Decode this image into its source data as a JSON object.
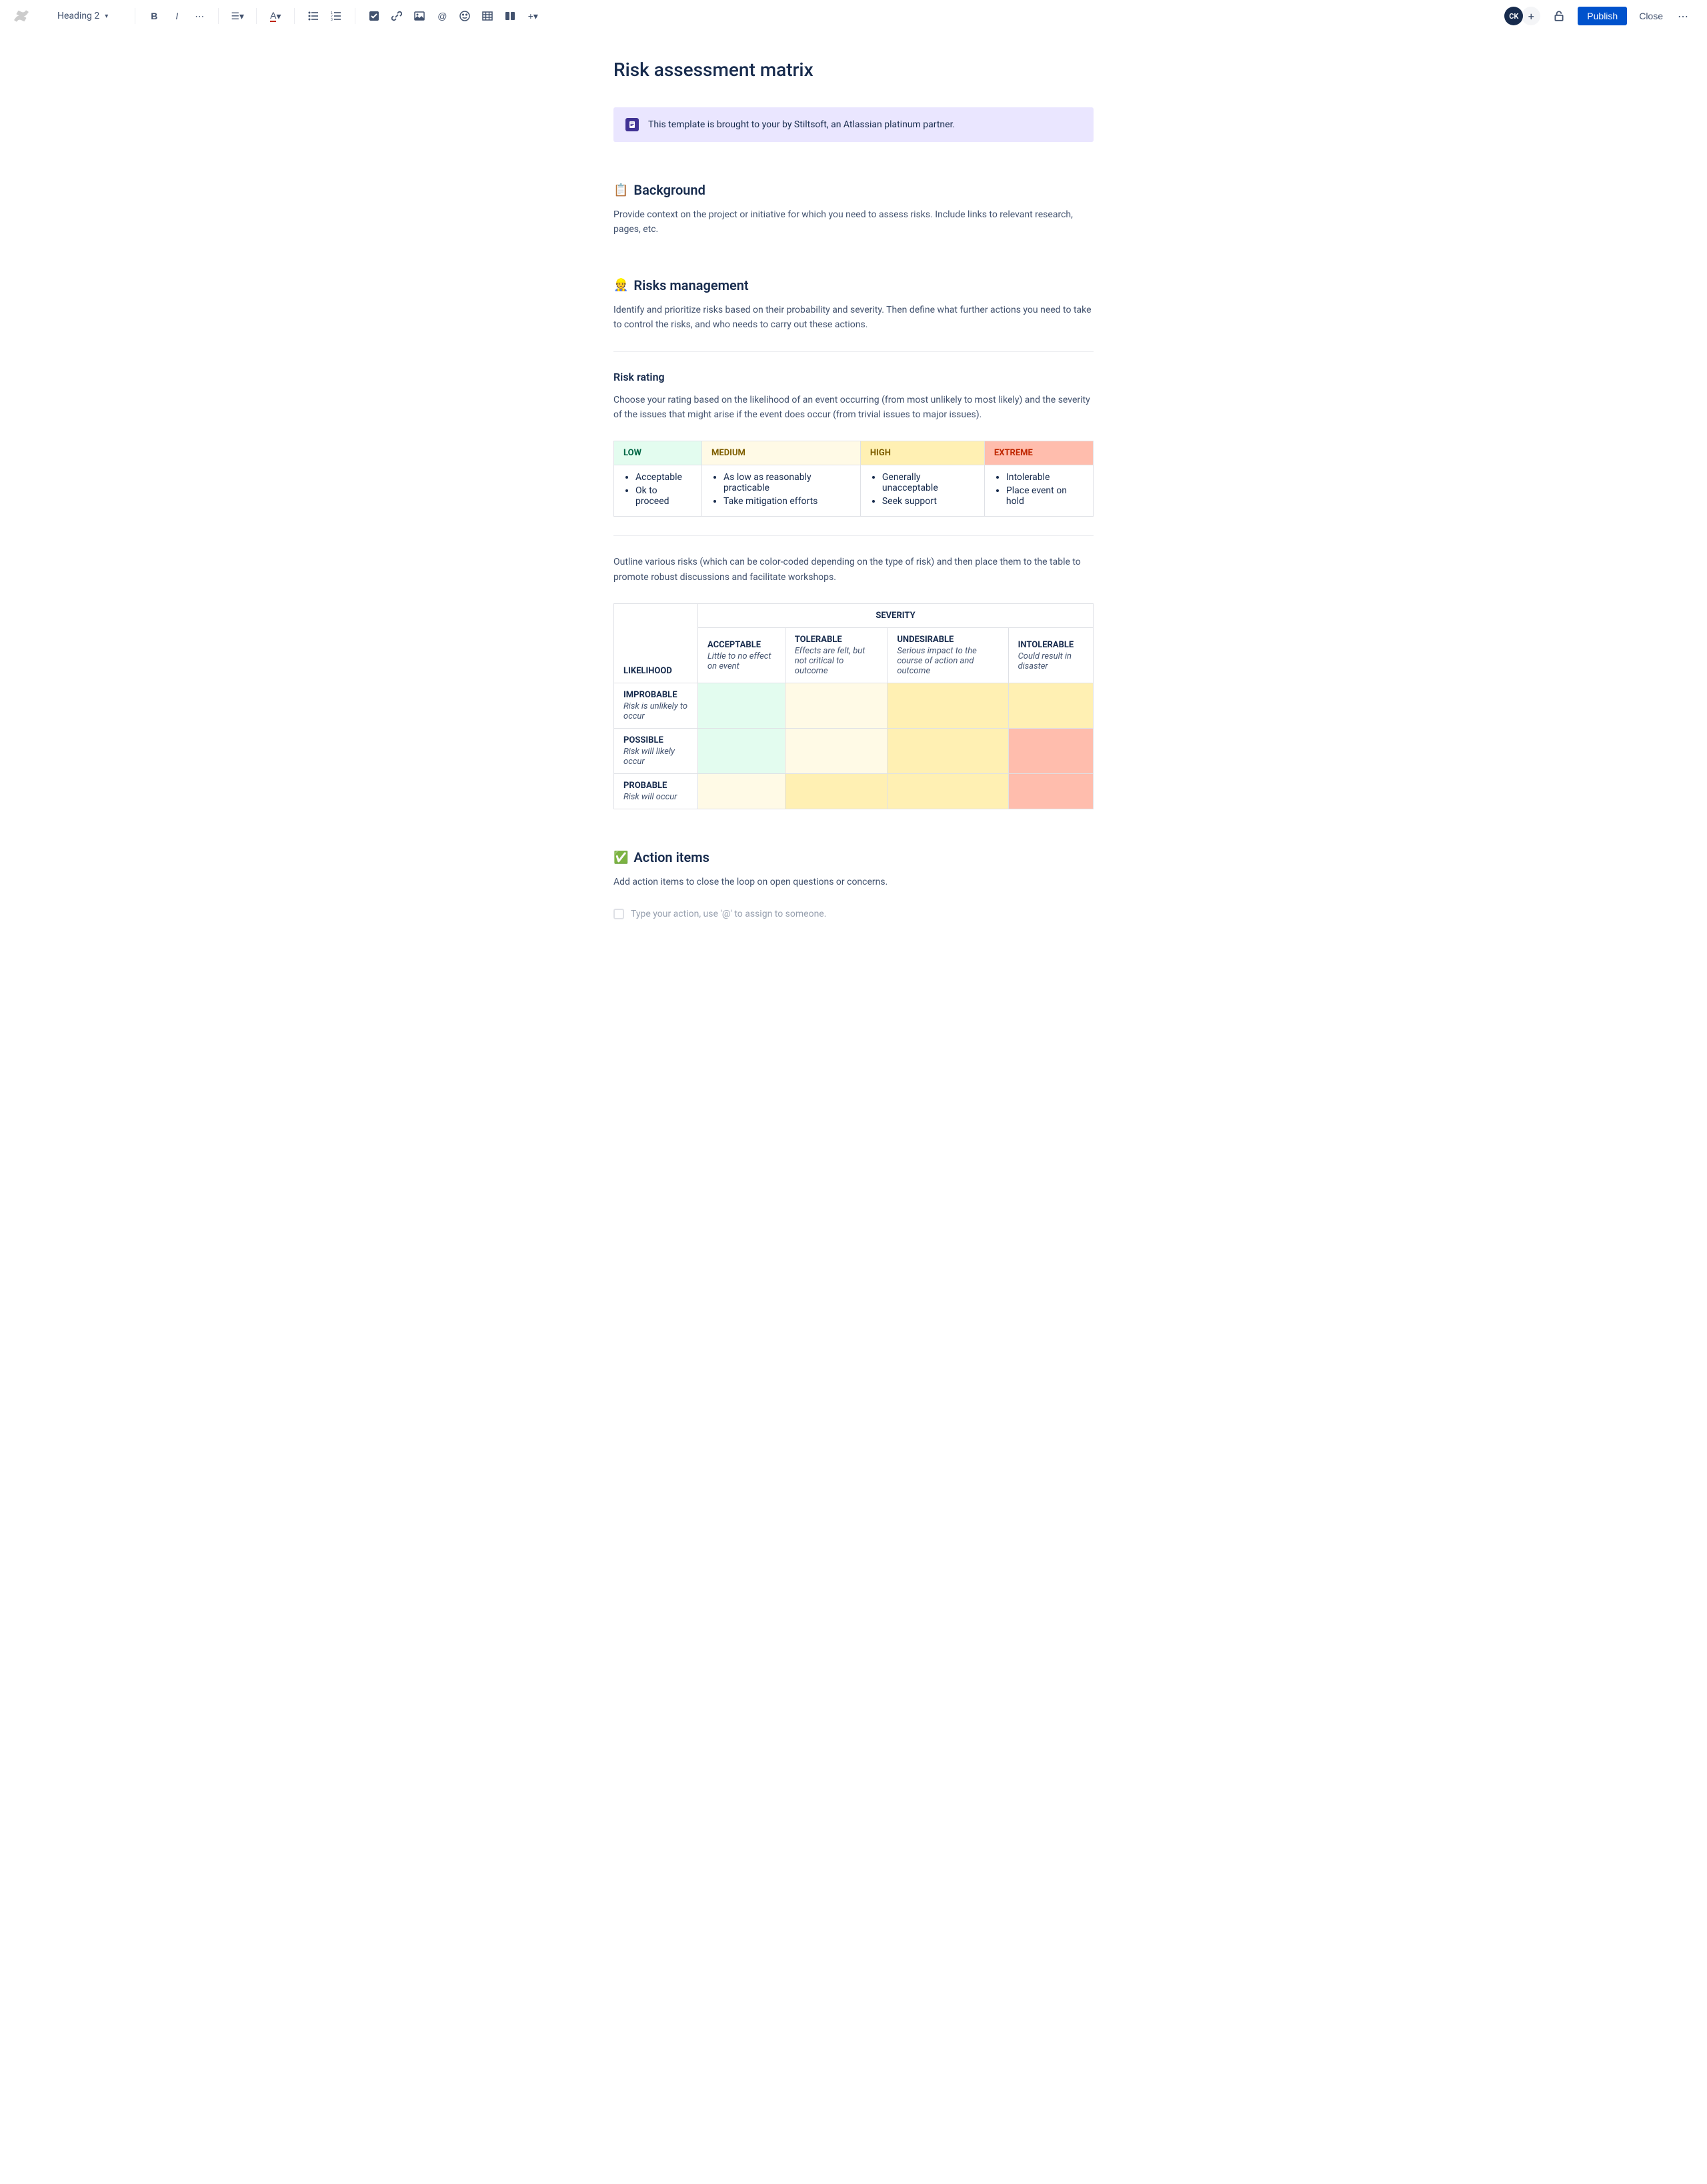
{
  "toolbar": {
    "heading_label": "Heading 2",
    "avatar_initials": "CK",
    "publish_label": "Publish",
    "close_label": "Close"
  },
  "page": {
    "title": "Risk assessment matrix"
  },
  "panel": {
    "text": "This template is brought to your by Stiltsoft, an Atlassian platinum partner."
  },
  "background": {
    "heading": "Background",
    "emoji": "📋",
    "body": "Provide context on the project or initiative for which you need to assess risks. Include links to relevant research, pages, etc."
  },
  "risks": {
    "heading": "Risks management",
    "emoji": "👷",
    "body": "Identify and prioritize risks based on their probability and severity. Then define what further actions you need to take to control the risks, and who needs to carry out these actions."
  },
  "rating": {
    "heading": "Risk rating",
    "body": "Choose your rating based on the likelihood of an event occurring (from most unlikely to most likely) and the severity of the issues that might arise if the event does occur (from trivial issues to major issues).",
    "headers": {
      "low": "LOW",
      "medium": "MEDIUM",
      "high": "HIGH",
      "extreme": "EXTREME"
    },
    "cells": {
      "low": [
        "Acceptable",
        "Ok to proceed"
      ],
      "medium": [
        "As low as reasonably practicable",
        "Take mitigation efforts"
      ],
      "high": [
        "Generally unacceptable",
        "Seek support"
      ],
      "extreme": [
        "Intolerable",
        "Place event on hold"
      ]
    }
  },
  "outline": {
    "body": "Outline various risks (which can be color-coded depending on the type of risk) and then place them to the table to promote robust discussions and facilitate workshops."
  },
  "matrix": {
    "severity_label": "SEVERITY",
    "likelihood_label": "LIKELIHOOD",
    "cols": [
      {
        "title": "ACCEPTABLE",
        "desc": "Little to no effect on event"
      },
      {
        "title": "TOLERABLE",
        "desc": "Effects are felt, but not critical to outcome"
      },
      {
        "title": "UNDESIRABLE",
        "desc": "Serious impact to the course of action and outcome"
      },
      {
        "title": "INTOLERABLE",
        "desc": "Could result in disaster"
      }
    ],
    "rows": [
      {
        "title": "IMPROBABLE",
        "desc": "Risk is unlikely to occur"
      },
      {
        "title": "POSSIBLE",
        "desc": "Risk will likely occur"
      },
      {
        "title": "PROBABLE",
        "desc": "Risk will occur"
      }
    ]
  },
  "action_items": {
    "heading": "Action items",
    "emoji": "✅",
    "body": "Add action items to close the loop on open questions or concerns.",
    "placeholder": "Type your action, use '@' to assign to someone."
  }
}
